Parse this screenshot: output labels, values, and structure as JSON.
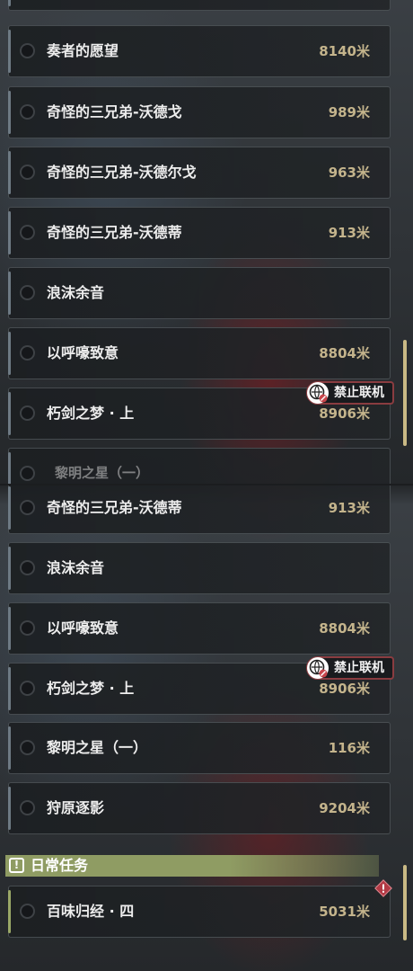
{
  "top_panel": {
    "partial_row_text": "黎明之星（一）",
    "quests": [
      {
        "name": "奏者的愿望",
        "distance": "8140米"
      },
      {
        "name": "奇怪的三兄弟-沃德戈",
        "distance": "989米"
      },
      {
        "name": "奇怪的三兄弟-沃德尔戈",
        "distance": "963米"
      },
      {
        "name": "奇怪的三兄弟-沃德蒂",
        "distance": "913米"
      },
      {
        "name": "浪沫余音",
        "distance": ""
      },
      {
        "name": "以呼嚎致意",
        "distance": "8804米"
      },
      {
        "name": "朽剑之梦 · 上",
        "distance": "8906米"
      }
    ],
    "badge": "禁止联机"
  },
  "bottom_panel": {
    "quests": [
      {
        "name": "奇怪的三兄弟-沃德蒂",
        "distance": "913米"
      },
      {
        "name": "浪沫余音",
        "distance": ""
      },
      {
        "name": "以呼嚎致意",
        "distance": "8804米"
      },
      {
        "name": "朽剑之梦 · 上",
        "distance": "8906米"
      },
      {
        "name": "黎明之星（一）",
        "distance": "116米"
      },
      {
        "name": "狩原逐影",
        "distance": "9204米"
      }
    ],
    "badge": "禁止联机",
    "daily_section": {
      "icon_symbol": "!",
      "title": "日常任务",
      "quest": {
        "name": "百味归经 · 四",
        "distance": "5031米"
      }
    }
  },
  "colors": {
    "distance": "#c4b48c",
    "badge_border": "#8a3c40",
    "daily_accent": "#8f9c63",
    "scrollbar": "#c9b985"
  }
}
